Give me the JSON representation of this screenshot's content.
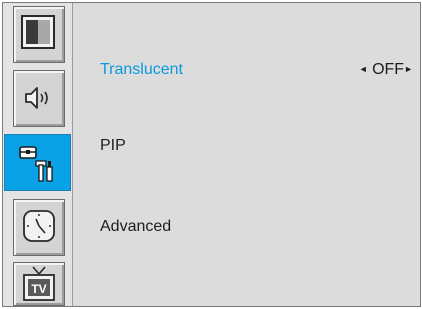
{
  "sidebar": {
    "items": [
      {
        "icon": "picture-icon",
        "active": false
      },
      {
        "icon": "sound-icon",
        "active": false
      },
      {
        "icon": "setup-tools-icon",
        "active": true
      },
      {
        "icon": "clock-icon",
        "active": false
      },
      {
        "icon": "tv-icon",
        "active": false
      }
    ]
  },
  "menu": {
    "items": [
      {
        "label": "Translucent",
        "selected": true
      },
      {
        "label": "PIP",
        "selected": false
      },
      {
        "label": "Advanced",
        "selected": false
      }
    ],
    "translucent_value": {
      "left_arrow": "◄",
      "value": "OFF",
      "right_arrow": "►"
    }
  },
  "colors": {
    "accent": "#0aa2e6",
    "selected_text": "#0b99db",
    "panel_bg": "#dcdcdc"
  }
}
